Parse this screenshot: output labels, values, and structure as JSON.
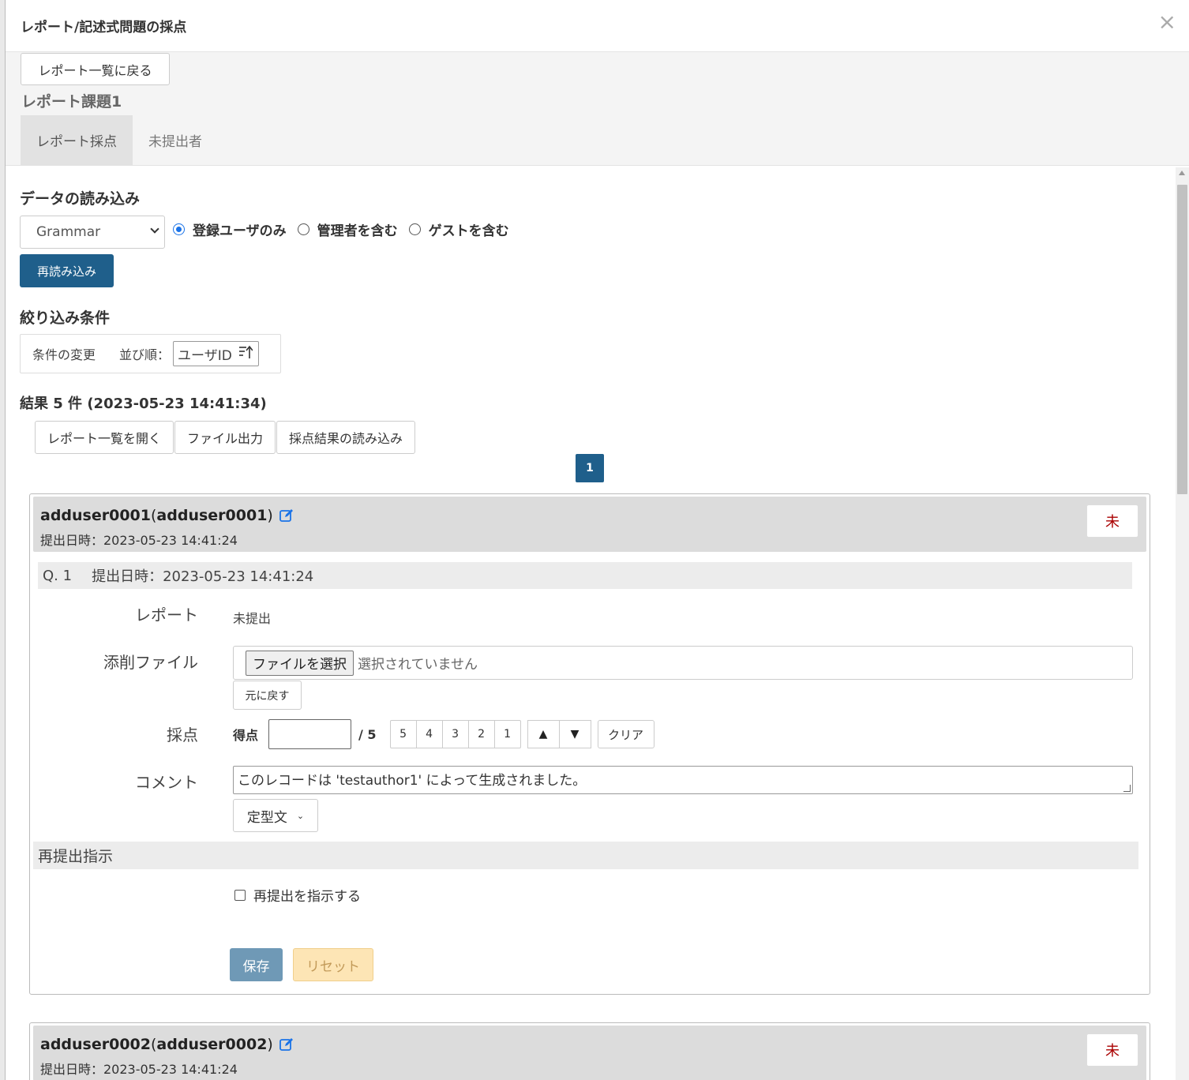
{
  "modal": {
    "title": "レポート/記述式問題の採点",
    "close": "×"
  },
  "back_button": "レポート一覧に戻る",
  "assignment_title": "レポート課題1",
  "tabs": [
    {
      "label": "レポート採点",
      "active": true
    },
    {
      "label": "未提出者",
      "active": false
    }
  ],
  "data_load": {
    "heading": "データの読み込み",
    "select_value": "Grammar",
    "radios": [
      {
        "label": "登録ユーザのみ",
        "checked": true
      },
      {
        "label": "管理者を含む",
        "checked": false
      },
      {
        "label": "ゲストを含む",
        "checked": false
      }
    ],
    "reload_button": "再読み込み"
  },
  "filter": {
    "heading": "絞り込み条件",
    "change_label": "条件の変更",
    "sort_label": "並び順：",
    "sort_value": "ユーザID",
    "sort_icon": "sort-ascending-icon"
  },
  "results": {
    "heading": "結果 5 件 (2023-05-23 14:41:34)",
    "actions": [
      "レポート一覧を開く",
      "ファイル出力",
      "採点結果の読み込み"
    ],
    "page": "1"
  },
  "cards": [
    {
      "user_id": "adduser0001",
      "user_name": "adduser0001",
      "submit_date": "提出日時：2023-05-23 14:41:24",
      "status": "未",
      "question_label": "Q. 1",
      "question_date": "提出日時：2023-05-23 14:41:24",
      "report_label": "レポート",
      "report_value": "未提出",
      "file_label": "添削ファイル",
      "file_button": "ファイルを選択",
      "file_status": "選択されていません",
      "revert_button": "元に戻す",
      "score_label_row": "採点",
      "score_label": "得点",
      "score_value": "",
      "score_max": "/ 5",
      "score_buttons": [
        "5",
        "4",
        "3",
        "2",
        "1"
      ],
      "arrow_up": "▲",
      "arrow_down": "▼",
      "clear_button": "クリア",
      "comment_label": "コメント",
      "comment_value": "このレコードは 'testauthor1' によって生成されました。",
      "template_button": "定型文",
      "template_chevron": "⌄",
      "resubmit_heading": "再提出指示",
      "resubmit_check_label": "再提出を指示する",
      "resubmit_checked": false,
      "save_button": "保存",
      "reset_button": "リセット"
    },
    {
      "user_id": "adduser0002",
      "user_name": "adduser0002",
      "submit_date": "提出日時：2023-05-23 14:41:24",
      "status": "未"
    }
  ],
  "colors": {
    "primary": "#1f5f8b",
    "save": "#6f99b6",
    "reset": "#fde5b5",
    "status_text": "#aa0000",
    "edit_icon": "#1a73e8"
  }
}
